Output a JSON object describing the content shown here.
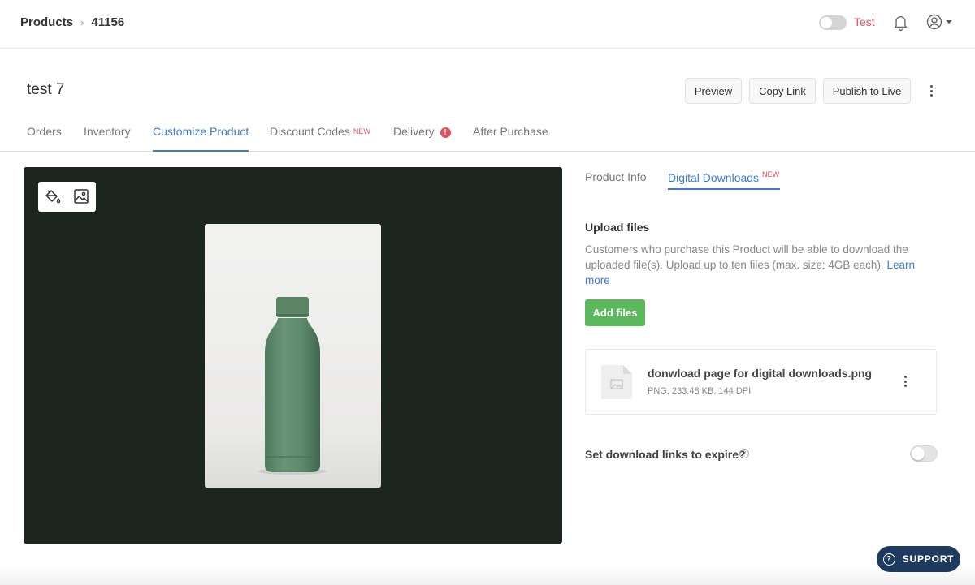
{
  "breadcrumb": {
    "root": "Products",
    "current": "41156"
  },
  "topbar": {
    "mode_label": "Test"
  },
  "header": {
    "title": "test 7",
    "buttons": {
      "preview": "Preview",
      "copy_link": "Copy Link",
      "publish": "Publish to Live"
    }
  },
  "tabs": {
    "orders": "Orders",
    "inventory": "Inventory",
    "customize": "Customize Product",
    "discount": "Discount Codes",
    "discount_badge": "NEW",
    "delivery": "Delivery",
    "delivery_alert": "!",
    "after_purchase": "After Purchase"
  },
  "sub_tabs": {
    "product_info": "Product Info",
    "digital_downloads": "Digital Downloads",
    "digital_badge": "NEW"
  },
  "upload": {
    "title": "Upload files",
    "description": "Customers who purchase this Product will be able to download the uploaded file(s). Upload up to ten files (max. size: 4GB each).",
    "learn_more": "Learn more",
    "add_button": "Add files"
  },
  "file": {
    "name": "donwload page for digital downloads.png",
    "meta": "PNG, 233.48 KB, 144 DPI"
  },
  "expire": {
    "label": "Set download links to expire?",
    "help": "?"
  },
  "support": {
    "label": "SUPPORT",
    "icon_glyph": "?"
  },
  "colors": {
    "accent": "#3a7bd5",
    "success": "#5cb85c",
    "alert": "#e0505a",
    "preview_bg": "#1c251e",
    "support_bg": "#1f3a5f"
  }
}
